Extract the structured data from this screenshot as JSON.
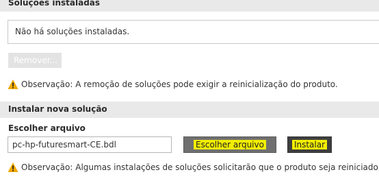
{
  "installed": {
    "header": "Soluções instaladas",
    "empty_text": "Não há soluções instaladas.",
    "remove_label": "Remover...",
    "note": "Observação: A remoção de soluções pode exigir a reinicialização do produto."
  },
  "install": {
    "header": "Instalar nova solução",
    "choose_label": "Escolher arquivo",
    "file_value": "pc-hp-futuresmart-CE.bdl",
    "browse_label": "Escolher arquivo",
    "install_label": "Instalar",
    "note": "Observação: Algumas instalações de soluções solicitarão que o produto seja reiniciado."
  },
  "colors": {
    "warning": "#f0a800",
    "highlight": "#f2ee00",
    "header_bg": "#e9e9e9"
  },
  "icons": {
    "warning": "warning-icon"
  }
}
